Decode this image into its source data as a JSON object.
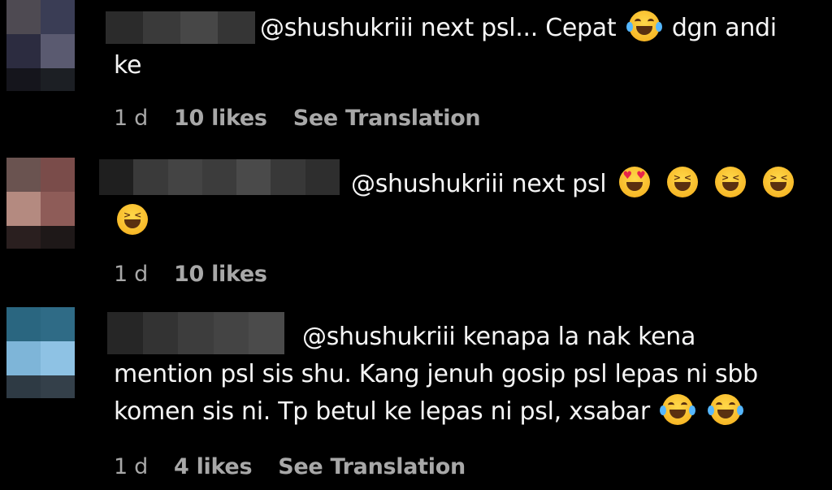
{
  "comments": [
    {
      "text_lines": [
        "@shushukriii next psl... Cepat",
        "dgn andi",
        "ke"
      ],
      "time": "1 d",
      "likes": "10 likes",
      "translate": "See Translation"
    },
    {
      "text_lines": [
        "@shushukriii next psl"
      ],
      "time": "1 d",
      "likes": "10 likes"
    },
    {
      "text_lines": [
        "@shushukriii kenapa la nak kena",
        "mention psl sis shu. Kang jenuh gosip psl lepas ni sbb",
        "komen sis ni. Tp betul ke lepas ni psl, xsabar"
      ],
      "time": "1 d",
      "likes": "4 likes",
      "translate": "See Translation"
    }
  ],
  "colors": {
    "background": "#000000",
    "text": "#f5f5f5",
    "meta": "#a8a8a8"
  },
  "icons": {
    "laugh": "face-with-tears-of-joy",
    "heart_eyes": "smiling-face-with-heart-eyes",
    "squint": "grinning-squinting-face"
  }
}
